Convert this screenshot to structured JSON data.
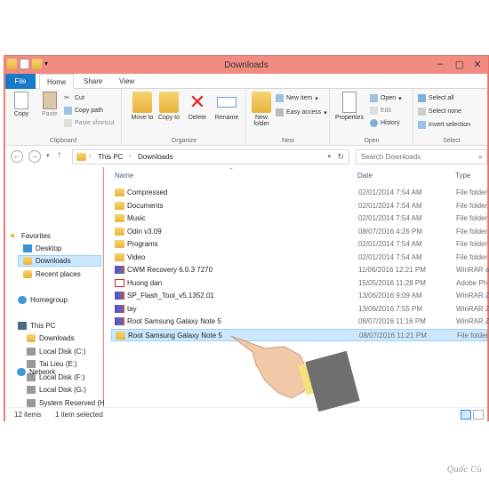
{
  "window": {
    "title": "Downloads"
  },
  "tabs": [
    "File",
    "Home",
    "Share",
    "View"
  ],
  "ribbon": {
    "clipboard": {
      "label": "Clipboard",
      "copy": "Copy",
      "paste": "Paste",
      "cut": "Cut",
      "copy_path": "Copy path",
      "paste_shortcut": "Paste shortcut"
    },
    "organize": {
      "label": "Organize",
      "move_to": "Move to",
      "copy_to": "Copy to",
      "delete": "Delete",
      "rename": "Rename"
    },
    "new": {
      "label": "New",
      "new_folder": "New folder",
      "new_item": "New item",
      "easy_access": "Easy access"
    },
    "open": {
      "label": "Open",
      "properties": "Properties",
      "open": "Open",
      "edit": "Edit",
      "history": "History"
    },
    "select": {
      "label": "Select",
      "select_all": "Select all",
      "select_none": "Select none",
      "invert_selection": "Invert selection"
    }
  },
  "address": {
    "crumbs": [
      "This PC",
      "Downloads"
    ],
    "search_placeholder": "Search Downloads"
  },
  "nav": {
    "favorites": "Favorites",
    "desktop": "Desktop",
    "downloads": "Downloads",
    "recent": "Recent places",
    "homegroup": "Homegroup",
    "this_pc": "This PC",
    "pc_downloads": "Downloads",
    "disk_c": "Local Disk (C:)",
    "disk_e": "Tai Lieu (E:)",
    "disk_f": "Local Disk (F:)",
    "disk_g": "Local Disk (G:)",
    "sys_reserved": "System Reserved (H:",
    "network": "Network"
  },
  "columns": {
    "name": "Name",
    "date": "Date",
    "type": "Type"
  },
  "files": [
    {
      "name": "Compressed",
      "date": "02/01/2014 7:54 AM",
      "type": "File folder",
      "icon": "folder"
    },
    {
      "name": "Documents",
      "date": "02/01/2014 7:54 AM",
      "type": "File folder",
      "icon": "folder"
    },
    {
      "name": "Music",
      "date": "02/01/2014 7:54 AM",
      "type": "File folder",
      "icon": "folder"
    },
    {
      "name": "Odin v3.09",
      "date": "08/07/2016 4:26 PM",
      "type": "File folder",
      "icon": "folder"
    },
    {
      "name": "Programs",
      "date": "02/01/2014 7:54 AM",
      "type": "File folder",
      "icon": "folder"
    },
    {
      "name": "Video",
      "date": "02/01/2014 7:54 AM",
      "type": "File folder",
      "icon": "folder"
    },
    {
      "name": "CWM Recovery 6.0.3 7270",
      "date": "11/06/2016 12:21 PM",
      "type": "WinRAR a",
      "icon": "winrar"
    },
    {
      "name": "Huong dan",
      "date": "15/05/2016 11:28 PM",
      "type": "Adobe Ph",
      "icon": "pdf"
    },
    {
      "name": "SP_Flash_Tool_v5.1352.01",
      "date": "13/06/2016 9:09 AM",
      "type": "WinRAR Z",
      "icon": "winrar"
    },
    {
      "name": "tay",
      "date": "13/06/2016 7:55 PM",
      "type": "WinRAR Z",
      "icon": "winrar"
    },
    {
      "name": "Root Samsung Galaxy Note 5",
      "date": "08/07/2016 11:16 PM",
      "type": "WinRAR Z",
      "icon": "winrar"
    },
    {
      "name": "Root Samsung Galaxy Note 5",
      "date": "08/07/2016 11:21 PM",
      "type": "File folder",
      "icon": "folder"
    }
  ],
  "status": {
    "count": "12 items",
    "selected": "1 item selected"
  },
  "watermark": "Quốc Cù",
  "colors": {
    "frame": "#f28b82",
    "file_tab": "#1979ca",
    "selection": "#cce8ff"
  }
}
